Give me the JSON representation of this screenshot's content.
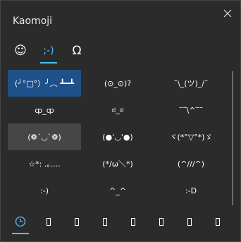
{
  "window": {
    "title": "Kaomoji",
    "close_icon": "close-icon"
  },
  "tabs": [
    {
      "label": "☺",
      "icon": "emoji-smiley-icon",
      "active": false
    },
    {
      "label": ";-)",
      "icon": "kaomoji-icon",
      "active": true
    },
    {
      "label": "Ω",
      "icon": "omega-symbol-icon",
      "active": false
    }
  ],
  "kaomoji": {
    "items": [
      "(╯°□°）╯︵ ┻━┻",
      "(⊙_⊙)?",
      "¯\\_(ツ)_/¯",
      "ȹ_ȹ",
      "ಠ_ಠ",
      "¯‾\\^‾¯",
      "(❁´◡`❁)",
      "(●'◡'●)",
      "ヾ(*°▽°*)ゞ",
      "☆*: .｡.... ",
      "(*/ω＼*)",
      "(^///^)",
      ":-)",
      "^_^",
      ":-D"
    ],
    "selected_index": 0,
    "hover_index": 6
  },
  "bottom_categories": [
    {
      "icon": "clock-icon",
      "active": true
    },
    {
      "icon": "unknown-glyph-icon",
      "active": false
    },
    {
      "icon": "unknown-glyph-icon",
      "active": false
    },
    {
      "icon": "unknown-glyph-icon",
      "active": false
    },
    {
      "icon": "unknown-glyph-icon",
      "active": false
    },
    {
      "icon": "unknown-glyph-icon",
      "active": false
    },
    {
      "icon": "unknown-glyph-icon",
      "active": false
    },
    {
      "icon": "unknown-glyph-icon",
      "active": false
    }
  ],
  "colors": {
    "background": "#2b2b2b",
    "accent": "#4cc2ff",
    "selected": "#1e5189",
    "hover": "#464646"
  }
}
